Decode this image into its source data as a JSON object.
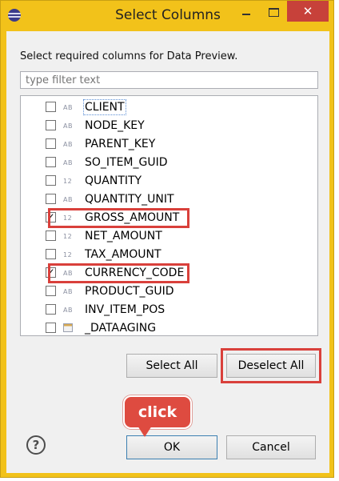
{
  "window": {
    "title": "Select Columns",
    "close_glyph": "✕"
  },
  "instruction": "Select required columns for Data Preview.",
  "filter": {
    "placeholder": "type filter text",
    "value": ""
  },
  "columns": [
    {
      "name": "CLIENT",
      "type": "AB",
      "checked": false
    },
    {
      "name": "NODE_KEY",
      "type": "AB",
      "checked": false
    },
    {
      "name": "PARENT_KEY",
      "type": "AB",
      "checked": false
    },
    {
      "name": "SO_ITEM_GUID",
      "type": "AB",
      "checked": false
    },
    {
      "name": "QUANTITY",
      "type": "12",
      "checked": false
    },
    {
      "name": "QUANTITY_UNIT",
      "type": "AB",
      "checked": false
    },
    {
      "name": "GROSS_AMOUNT",
      "type": "12",
      "checked": true
    },
    {
      "name": "NET_AMOUNT",
      "type": "12",
      "checked": false
    },
    {
      "name": "TAX_AMOUNT",
      "type": "12",
      "checked": false
    },
    {
      "name": "CURRENCY_CODE",
      "type": "AB",
      "checked": true
    },
    {
      "name": "PRODUCT_GUID",
      "type": "AB",
      "checked": false
    },
    {
      "name": "INV_ITEM_POS",
      "type": "AB",
      "checked": false
    },
    {
      "name": "_DATAAGING",
      "type": "datetime",
      "checked": false
    }
  ],
  "buttons": {
    "select_all": "Select All",
    "deselect_all": "Deselect All",
    "ok": "OK",
    "cancel": "Cancel"
  },
  "help_glyph": "?",
  "annotation": {
    "callout": "click"
  },
  "colors": {
    "highlight": "#d9403b",
    "callout": "#de4b40",
    "frame": "#f2c21a",
    "close": "#c7413a"
  }
}
